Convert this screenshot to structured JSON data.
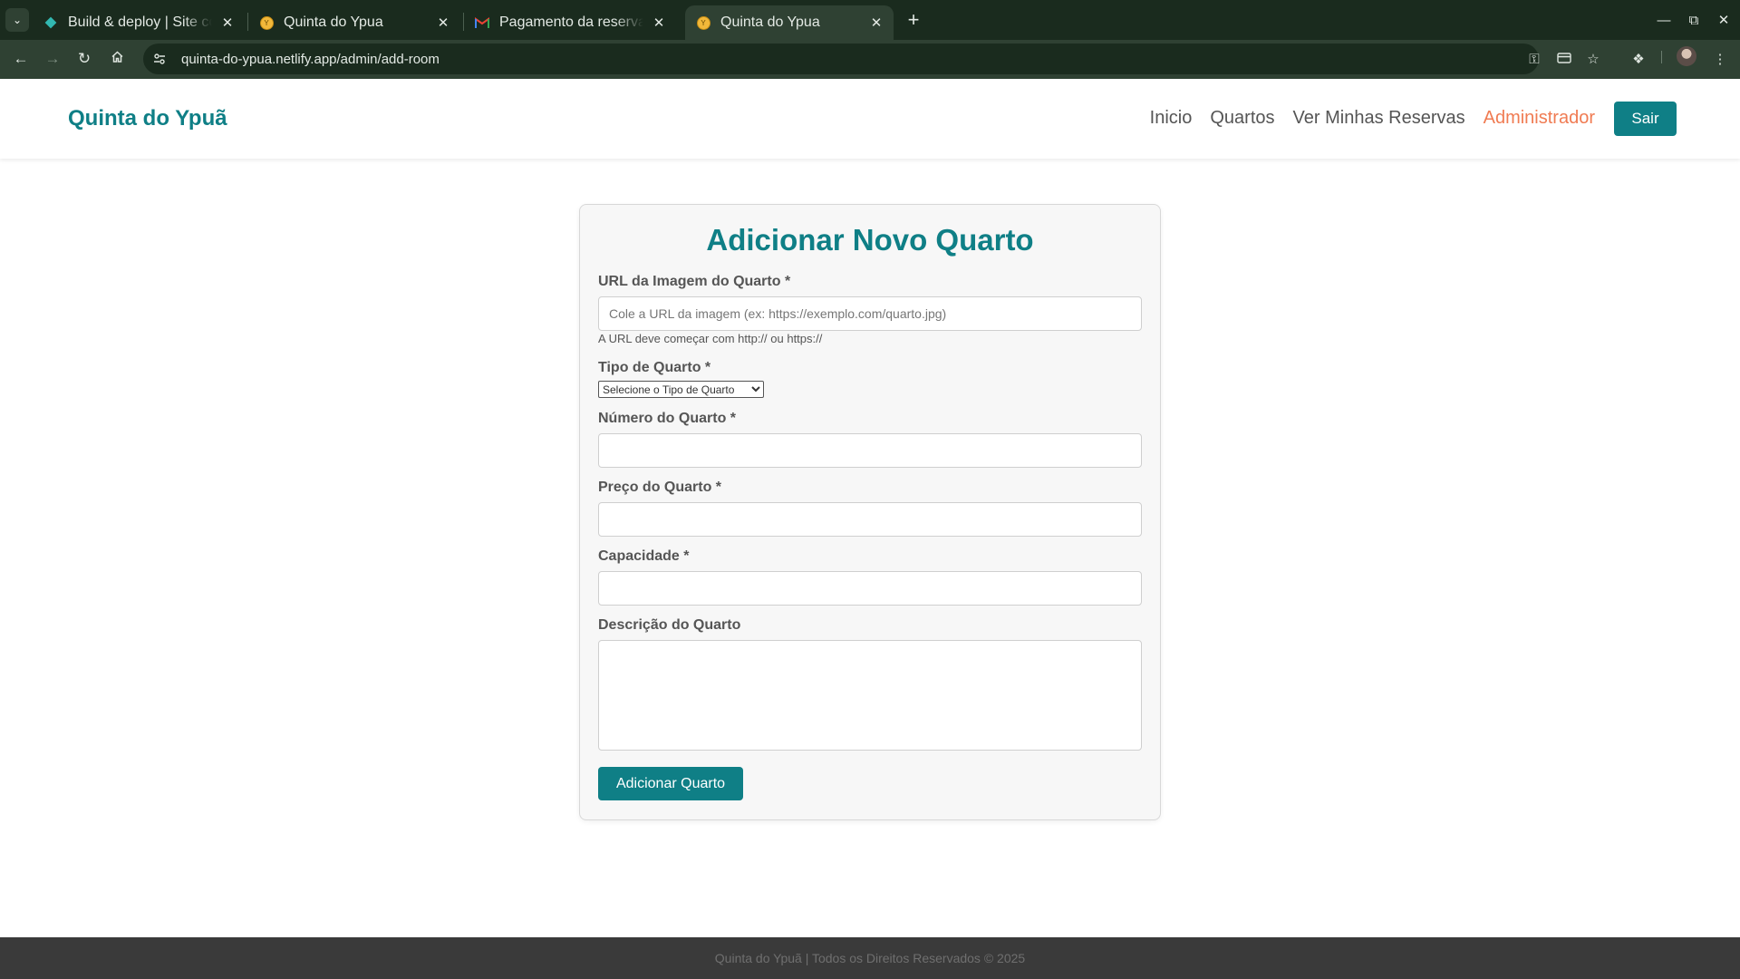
{
  "browser": {
    "tabs": [
      {
        "title": "Build & deploy | Site configuration",
        "icon": "netlify-diamond-icon"
      },
      {
        "title": "Quinta do Ypua",
        "icon": "site-favicon-icon"
      },
      {
        "title": "Pagamento da reserva recebido",
        "icon": "gmail-icon"
      },
      {
        "title": "Quinta do Ypua",
        "icon": "site-favicon-icon",
        "active": true
      }
    ],
    "url": "quinta-do-ypua.netlify.app/admin/add-room"
  },
  "header": {
    "brand": "Quinta do Ypuã",
    "nav": [
      {
        "label": "Inicio"
      },
      {
        "label": "Quartos"
      },
      {
        "label": "Ver Minhas Reservas"
      },
      {
        "label": "Administrador",
        "active": true
      }
    ],
    "logout_label": "Sair"
  },
  "form": {
    "title": "Adicionar Novo Quarto",
    "image_url": {
      "label": "URL da Imagem do Quarto *",
      "placeholder": "Cole a URL da imagem (ex: https://exemplo.com/quarto.jpg)",
      "hint": "A URL deve começar com http:// ou https://"
    },
    "room_type": {
      "label": "Tipo de Quarto *",
      "selected": "Selecione o Tipo de Quarto"
    },
    "room_number": {
      "label": "Número do Quarto *",
      "value": ""
    },
    "room_price": {
      "label": "Preço do Quarto *",
      "value": ""
    },
    "capacity": {
      "label": "Capacidade *",
      "value": ""
    },
    "description": {
      "label": "Descrição do Quarto",
      "value": ""
    },
    "submit_label": "Adicionar Quarto"
  },
  "footer": {
    "text": "Quinta do Ypuã | Todos os Direitos Reservados © 2025"
  },
  "colors": {
    "brand": "#0f7f86",
    "active_nav": "#f07b52",
    "browser_frame": "#1a2b1e",
    "footer_bg": "#3a3a3a"
  }
}
